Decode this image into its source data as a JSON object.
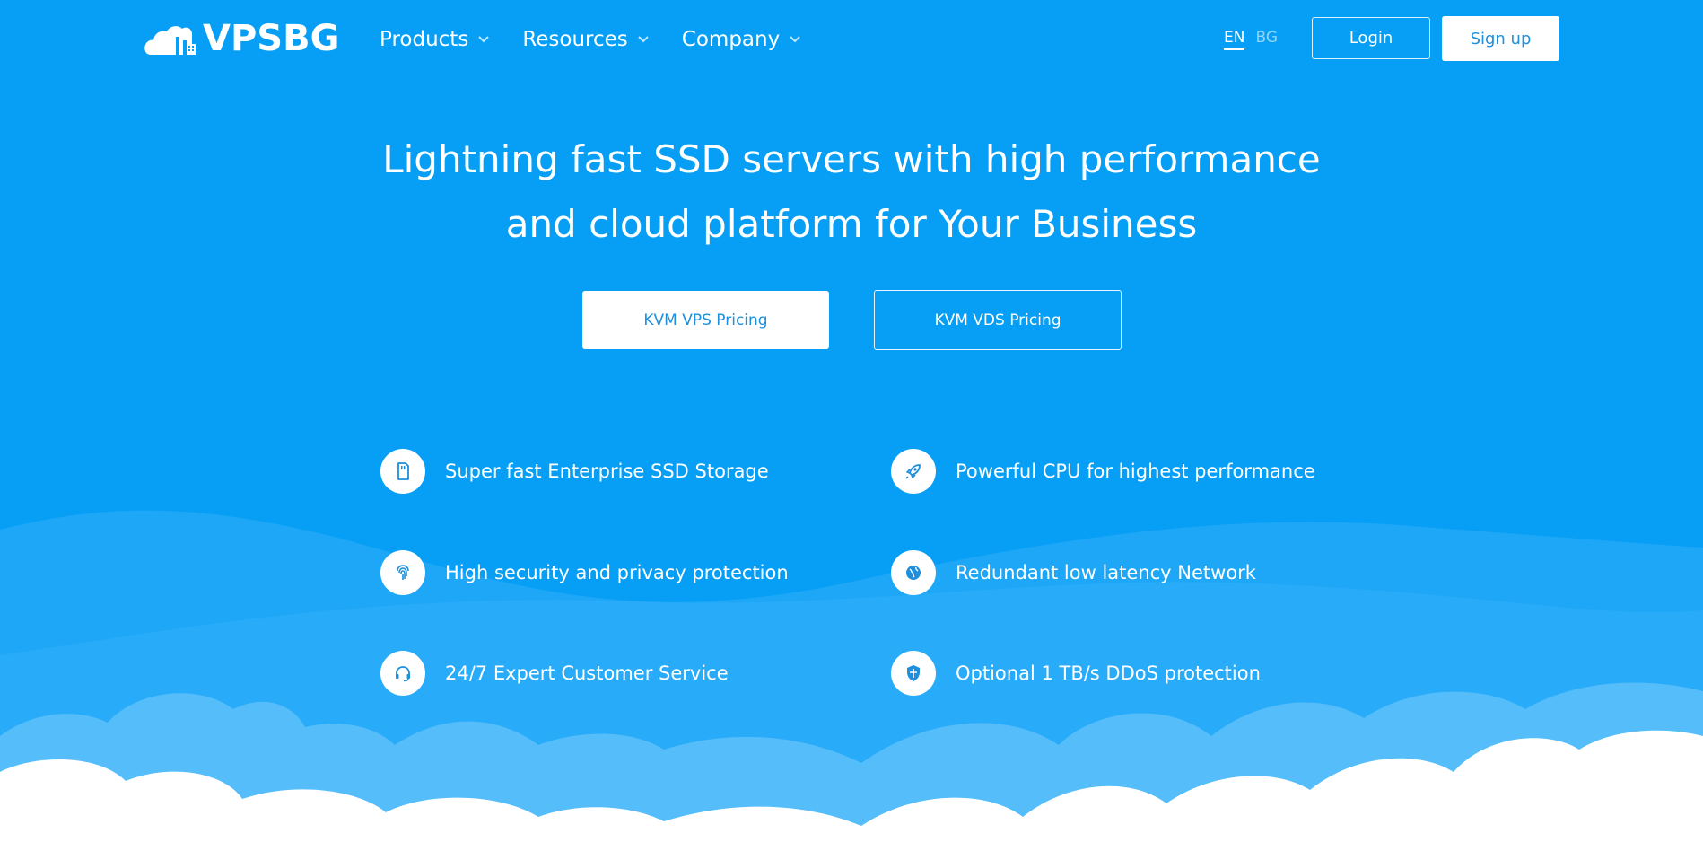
{
  "brand": {
    "name": "VPSBG",
    "logo_icon": "cloud-building-icon"
  },
  "nav": {
    "items": [
      {
        "label": "Products"
      },
      {
        "label": "Resources"
      },
      {
        "label": "Company"
      }
    ]
  },
  "lang": {
    "active": "EN",
    "inactive": "BG"
  },
  "auth": {
    "login_label": "Login",
    "signup_label": "Sign up"
  },
  "hero": {
    "line1": "Lightning fast SSD servers with high performance",
    "line2": "and cloud platform for Your Business",
    "cta_primary": "KVM VPS Pricing",
    "cta_secondary": "KVM VDS Pricing"
  },
  "features": [
    {
      "label": "Super fast Enterprise SSD Storage",
      "icon": "sd-card-icon"
    },
    {
      "label": "Powerful CPU for highest performance",
      "icon": "rocket-icon"
    },
    {
      "label": "High security and privacy protection",
      "icon": "fingerprint-icon"
    },
    {
      "label": "Redundant low latency Network",
      "icon": "globe-icon"
    },
    {
      "label": "24/7 Expert Customer Service",
      "icon": "headset-icon"
    },
    {
      "label": "Optional 1 TB/s DDoS protection",
      "icon": "shield-icon"
    }
  ],
  "colors": {
    "background": "#079ff5",
    "wave_light": "#29aaf7",
    "cloud_mid": "#55bdfa",
    "cloud_white": "#ffffff",
    "button_text": "#1d8fdc"
  }
}
